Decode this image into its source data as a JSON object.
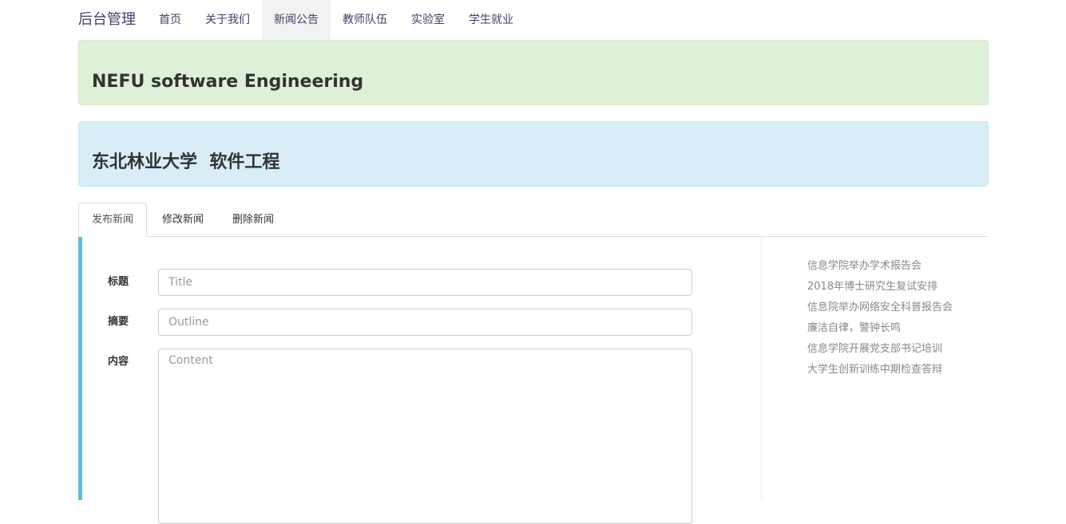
{
  "navbar": {
    "brand": "后台管理",
    "items": [
      {
        "label": "首页",
        "active": false
      },
      {
        "label": "关于我们",
        "active": false
      },
      {
        "label": "新闻公告",
        "active": true
      },
      {
        "label": "教师队伍",
        "active": false
      },
      {
        "label": "实验室",
        "active": false
      },
      {
        "label": "学生就业",
        "active": false
      }
    ]
  },
  "banners": {
    "english_title": "NEFU software Engineering",
    "chinese_title": "东北林业大学  软件工程"
  },
  "tabs": [
    {
      "label": "发布新闻",
      "active": true
    },
    {
      "label": "修改新闻",
      "active": false
    },
    {
      "label": "删除新闻",
      "active": false
    }
  ],
  "form": {
    "title_label": "标题",
    "title_placeholder": "Title",
    "outline_label": "摘要",
    "outline_placeholder": "Outline",
    "content_label": "内容",
    "content_placeholder": "Content"
  },
  "news": [
    "信息学院举办学术报告会",
    "2018年博士研究生复试安排",
    "信息院举办网络安全科普报告会",
    "廉洁自律，警钟长鸣",
    "信息学院开展党支部书记培训",
    "大学生创新训练中期检查答辩"
  ],
  "colors": {
    "accent_bar": "#5bc0de",
    "banner_green": "#dff0d8",
    "banner_blue": "#d9edf7"
  }
}
